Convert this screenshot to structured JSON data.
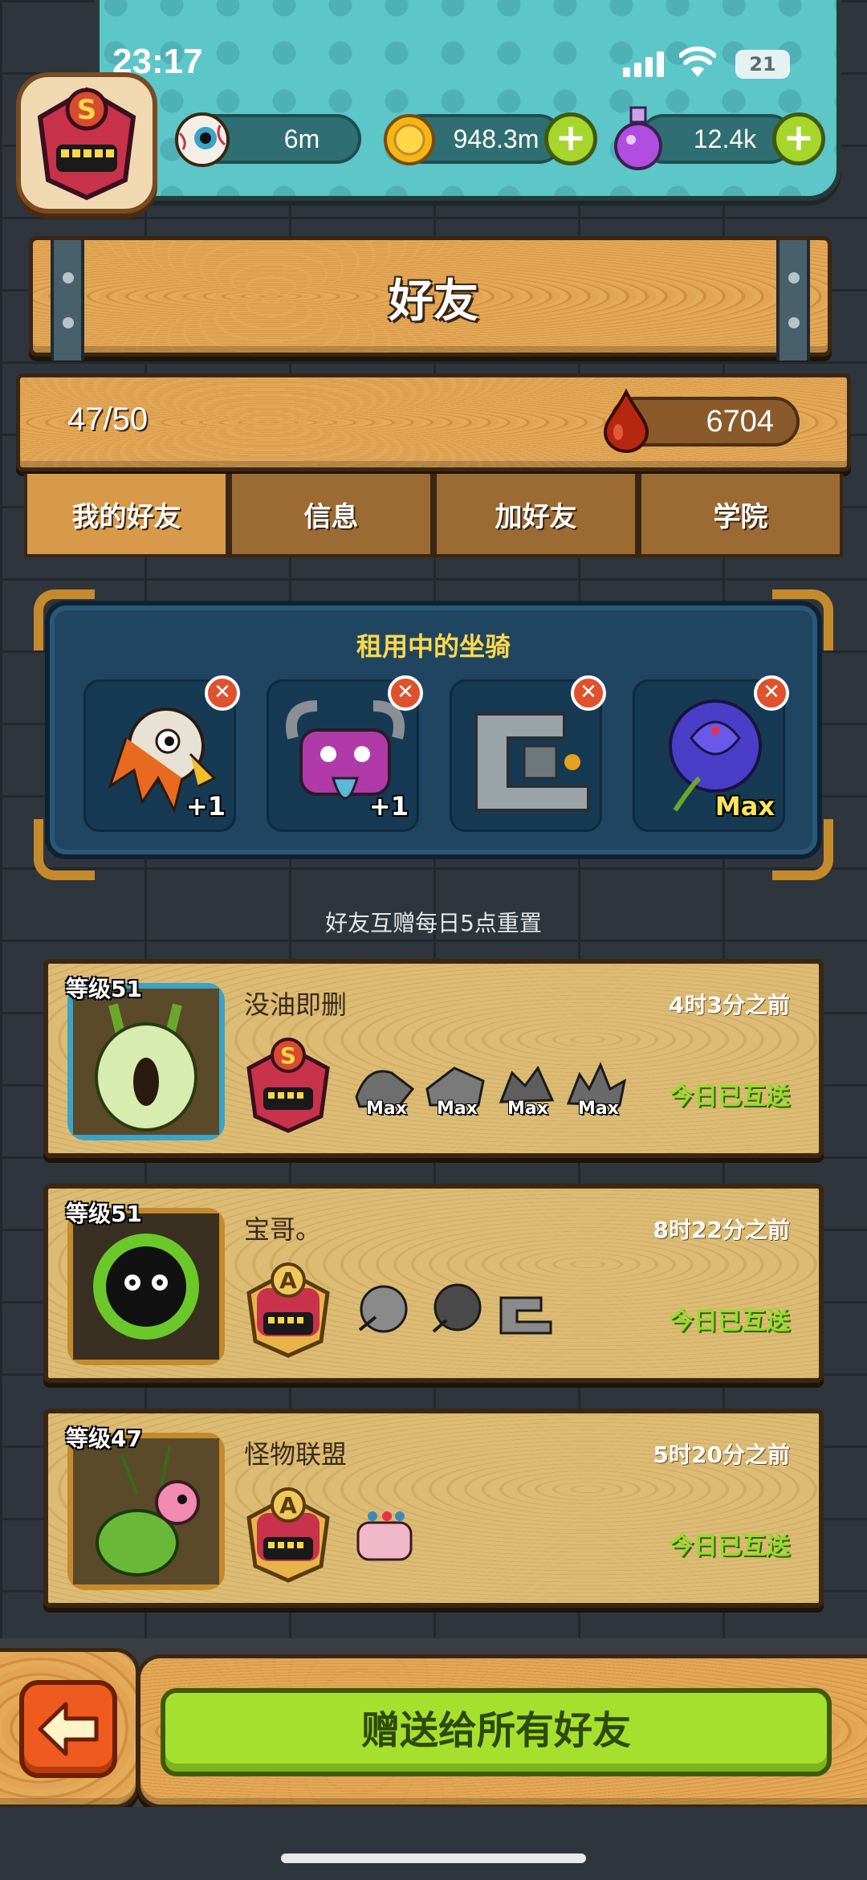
{
  "status_bar": {
    "time": "23:17",
    "battery": "21"
  },
  "player": {
    "rank_letter": "S"
  },
  "resources": {
    "eyeball": "6m",
    "coins": "948.3m",
    "potion": "12.4k"
  },
  "page": {
    "title": "好友",
    "friend_count": "47/50",
    "blood_drops": "6704"
  },
  "tabs": [
    {
      "label": "我的好友",
      "active": true
    },
    {
      "label": "信息",
      "active": false
    },
    {
      "label": "加好友",
      "active": false
    },
    {
      "label": "学院",
      "active": false
    }
  ],
  "rented_mounts": {
    "title": "租用中的坐骑",
    "slots": [
      {
        "label": "+1",
        "icon": "lion-dance-mount-icon"
      },
      {
        "label": "+1",
        "icon": "purple-horned-monster-mount-icon"
      },
      {
        "label": "",
        "icon": "robot-machine-mount-icon"
      },
      {
        "label": "Max",
        "icon": "purple-rose-mount-icon"
      }
    ]
  },
  "reset_note": "好友互赠每日5点重置",
  "friends": [
    {
      "level": "等级51",
      "name": "没油即删",
      "last_seen": "4时3分之前",
      "rank": "S",
      "status": "今日已互送",
      "mounts": [
        "Max",
        "Max",
        "Max",
        "Max"
      ]
    },
    {
      "level": "等级51",
      "name": "宝哥。",
      "last_seen": "8时22分之前",
      "rank": "A",
      "status": "今日已互送",
      "mounts": [
        "",
        "",
        ""
      ]
    },
    {
      "level": "等级47",
      "name": "怪物联盟",
      "last_seen": "5时20分之前",
      "rank": "A",
      "status": "今日已互送",
      "mounts": [
        ""
      ]
    }
  ],
  "bottom": {
    "gift_all_label": "赠送给所有好友"
  },
  "colors": {
    "gold": "#ffd84a",
    "green_status": "#8fe02a",
    "wood": "#d79a4a",
    "panel_blue": "#1f4561"
  }
}
